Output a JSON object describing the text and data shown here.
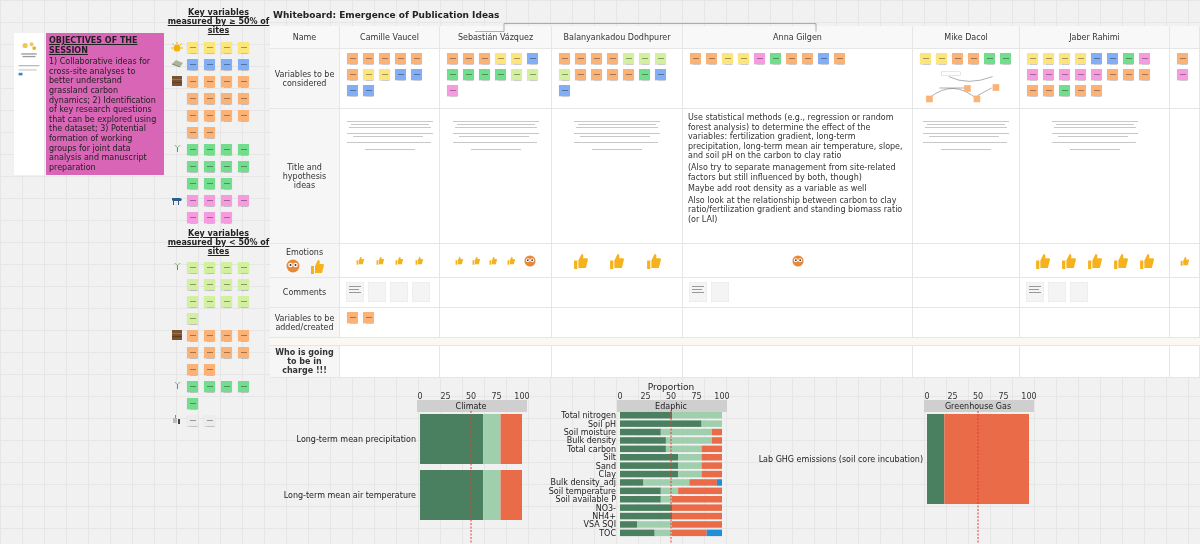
{
  "intro": {
    "objectives_title": "OBJECTIVES OF THE SESSION",
    "objectives": "1) Collaborative ideas for cross-site analyses to better understand grassland carbon dynamics; 2) Identification of key research questions that can be explored using the dataset; 3) Potential formation of working groups for joint data analysis and manuscript preparation"
  },
  "key_variables": [
    {
      "heading": "Key variables measured by ≥ 50% of sites",
      "groups": [
        {
          "kind": "sun",
          "notes": [
            {
              "color": "#fce57b"
            },
            {
              "color": "#fce57b"
            },
            {
              "color": "#fce57b"
            },
            {
              "color": "#fce57b"
            }
          ]
        },
        {
          "kind": "stone",
          "notes": [
            {
              "color": "#82aef5"
            },
            {
              "color": "#82aef5"
            },
            {
              "color": "#82aef5"
            },
            {
              "color": "#82aef5"
            }
          ]
        },
        {
          "kind": "soil",
          "notes": [
            {
              "color": "#fbb276"
            },
            {
              "color": "#fbb276"
            },
            {
              "color": "#fbb276"
            },
            {
              "color": "#fbb276"
            },
            {
              "color": "#fbb276"
            },
            {
              "color": "#fbb276"
            },
            {
              "color": "#fbb276"
            },
            {
              "color": "#fbb276"
            },
            {
              "color": "#fbb276"
            },
            {
              "color": "#fbb276"
            },
            {
              "color": "#fbb276"
            },
            {
              "color": "#fbb276"
            },
            {
              "color": "#fbb276"
            },
            {
              "color": "#fbb276"
            }
          ]
        },
        {
          "kind": "plant",
          "notes": [
            {
              "color": "#72dd8c"
            },
            {
              "color": "#72dd8c"
            },
            {
              "color": "#72dd8c"
            },
            {
              "color": "#72dd8c"
            },
            {
              "color": "#72dd8c"
            },
            {
              "color": "#72dd8c"
            },
            {
              "color": "#72dd8c"
            },
            {
              "color": "#72dd8c"
            },
            {
              "color": "#72dd8c"
            },
            {
              "color": "#72dd8c"
            },
            {
              "color": "#72dd8c"
            }
          ]
        },
        {
          "kind": "animal",
          "notes": [
            {
              "color": "#f69bdf"
            },
            {
              "color": "#f69bdf"
            },
            {
              "color": "#f69bdf"
            },
            {
              "color": "#f69bdf"
            },
            {
              "color": "#f69bdf"
            },
            {
              "color": "#f69bdf"
            },
            {
              "color": "#f69bdf"
            }
          ]
        }
      ]
    },
    {
      "heading": "Key variables measured by < 50% of sites",
      "groups": [
        {
          "kind": "plant",
          "notes": [
            {
              "color": "#d3f0a0"
            },
            {
              "color": "#d3f0a0"
            },
            {
              "color": "#d3f0a0"
            },
            {
              "color": "#d3f0a0"
            },
            {
              "color": "#d3f0a0"
            },
            {
              "color": "#d3f0a0"
            },
            {
              "color": "#d3f0a0"
            },
            {
              "color": "#d3f0a0"
            },
            {
              "color": "#d3f0a0"
            },
            {
              "color": "#d3f0a0"
            },
            {
              "color": "#d3f0a0"
            },
            {
              "color": "#d3f0a0"
            },
            {
              "color": "#d3f0a0"
            }
          ]
        },
        {
          "kind": "soil",
          "notes": [
            {
              "color": "#fbb276"
            },
            {
              "color": "#fbb276"
            },
            {
              "color": "#fbb276"
            },
            {
              "color": "#fbb276"
            },
            {
              "color": "#fbb276"
            },
            {
              "color": "#fbb276"
            },
            {
              "color": "#fbb276"
            },
            {
              "color": "#fbb276"
            },
            {
              "color": "#fbb276"
            },
            {
              "color": "#fbb276"
            }
          ]
        },
        {
          "kind": "plant",
          "notes": [
            {
              "color": "#72dd8c"
            },
            {
              "color": "#72dd8c"
            },
            {
              "color": "#72dd8c"
            },
            {
              "color": "#72dd8c"
            },
            {
              "color": "#72dd8c"
            }
          ]
        },
        {
          "kind": "tools",
          "notes": [
            {
              "color": "#ececec"
            },
            {
              "color": "#ececec"
            }
          ]
        }
      ]
    }
  ],
  "board": {
    "title": "Whiteboard: Emergence of Publication Ideas",
    "name_label": "Name",
    "row_labels": [
      "Variables to be considered",
      "Title and hypothesis ideas",
      "Emotions",
      "Comments",
      "Variables to be added/created",
      "Who is going to be in charge !!!"
    ],
    "columns": [
      {
        "name": "Camille Vaucel",
        "variables": [
          {
            "color": "#fbb276"
          },
          {
            "color": "#fbb276"
          },
          {
            "color": "#fbb276"
          },
          {
            "color": "#fbb276"
          },
          {
            "color": "#fbb276"
          },
          {
            "color": "#fbb276"
          },
          {
            "color": "#fce57b"
          },
          {
            "color": "#fce57b"
          },
          {
            "color": "#82aef5"
          },
          {
            "color": "#82aef5"
          },
          {
            "color": "#82aef5"
          },
          {
            "color": "#82aef5"
          }
        ],
        "added": [
          {
            "color": "#fbb276"
          },
          {
            "color": "#fbb276"
          }
        ]
      },
      {
        "name": "Sebastián Vázquez",
        "variables": [
          {
            "color": "#fbb276"
          },
          {
            "color": "#fbb276"
          },
          {
            "color": "#fbb276"
          },
          {
            "color": "#fce57b"
          },
          {
            "color": "#fce57b"
          },
          {
            "color": "#82aef5"
          },
          {
            "color": "#72dd8c"
          },
          {
            "color": "#72dd8c"
          },
          {
            "color": "#72dd8c"
          },
          {
            "color": "#72dd8c"
          },
          {
            "color": "#d3f0a0"
          },
          {
            "color": "#d3f0a0"
          },
          {
            "color": "#f69bdf"
          }
        ]
      },
      {
        "name": "Balanyankadou Dodhpurer",
        "variables": [
          {
            "color": "#fbb276"
          },
          {
            "color": "#fbb276"
          },
          {
            "color": "#fbb276"
          },
          {
            "color": "#fbb276"
          },
          {
            "color": "#d3f0a0"
          },
          {
            "color": "#d3f0a0"
          },
          {
            "color": "#d3f0a0"
          },
          {
            "color": "#d3f0a0"
          },
          {
            "color": "#fbb276"
          },
          {
            "color": "#fbb276"
          },
          {
            "color": "#fbb276"
          },
          {
            "color": "#fbb276"
          },
          {
            "color": "#72dd8c"
          },
          {
            "color": "#82aef5"
          },
          {
            "color": "#82aef5"
          }
        ]
      },
      {
        "name": "Anna Gilgen",
        "variables": [
          {
            "color": "#fbb276"
          },
          {
            "color": "#fbb276"
          },
          {
            "color": "#fce57b"
          },
          {
            "color": "#fce57b"
          },
          {
            "color": "#f69bdf"
          },
          {
            "color": "#72dd8c"
          },
          {
            "color": "#fbb276"
          },
          {
            "color": "#fbb276"
          },
          {
            "color": "#82aef5"
          },
          {
            "color": "#fbb276"
          }
        ],
        "hypotheses": [
          "Use statistical methods (e.g., regression or random forest analysis) to determine the effect of the variables: fertilization gradient, long-term precipitation, long-term mean air temperature, slope, and soil pH on the carbon to clay ratio",
          "(Also try to separate management from site-related factors but still influenced by both, though)",
          "Maybe add root density as a variable as well",
          "Also look at the relationship between carbon to clay ratio/fertilization gradient and standing biomass ratio (or LAI)"
        ]
      },
      {
        "name": "Mike Dacol",
        "variables": [
          {
            "color": "#fce57b"
          },
          {
            "color": "#fce57b"
          },
          {
            "color": "#fbb276"
          },
          {
            "color": "#fbb276"
          },
          {
            "color": "#72dd8c"
          },
          {
            "color": "#72dd8c"
          }
        ]
      },
      {
        "name": "Jaber Rahimi",
        "variables": [
          {
            "color": "#fce57b"
          },
          {
            "color": "#fce57b"
          },
          {
            "color": "#fce57b"
          },
          {
            "color": "#fce57b"
          },
          {
            "color": "#82aef5"
          },
          {
            "color": "#82aef5"
          },
          {
            "color": "#72dd8c"
          },
          {
            "color": "#f69bdf"
          },
          {
            "color": "#f69bdf"
          },
          {
            "color": "#f69bdf"
          },
          {
            "color": "#f69bdf"
          },
          {
            "color": "#f69bdf"
          },
          {
            "color": "#f69bdf"
          },
          {
            "color": "#fbb276"
          },
          {
            "color": "#fbb276"
          },
          {
            "color": "#fbb276"
          },
          {
            "color": "#fbb276"
          },
          {
            "color": "#fbb276"
          },
          {
            "color": "#72dd8c"
          },
          {
            "color": "#fbb276"
          },
          {
            "color": "#fbb276"
          }
        ]
      },
      {
        "variables": [
          {
            "color": "#fbb276"
          },
          {
            "color": "#f69bdf"
          }
        ]
      }
    ]
  },
  "charts": [
    {
      "chart_data": {
        "type": "bar",
        "orientation": "horizontal",
        "stacked": true,
        "title": "Climate",
        "categories": [
          "Long-term mean precipitation",
          "Long-term mean air temperature"
        ],
        "xlim": [
          0,
          100
        ],
        "xticks": [
          0,
          25,
          50,
          75,
          100
        ],
        "ref_lines": [
          {
            "axis": "x",
            "value": 50
          }
        ],
        "series": [
          {
            "color": "#4a8060",
            "values": [
              62,
              62
            ]
          },
          {
            "color": "#9fcfad",
            "values": [
              17,
              17
            ]
          },
          {
            "color": "#ea6b48",
            "values": [
              21,
              21
            ]
          }
        ]
      }
    },
    {
      "chart_data": {
        "type": "bar",
        "orientation": "horizontal",
        "stacked": true,
        "title": "Edaphic",
        "xlabel": "Proportion",
        "categories": [
          "Total nitrogen",
          "Soil pH",
          "Soil moisture",
          "Bulk density",
          "Total carbon",
          "Silt",
          "Sand",
          "Clay",
          "Bulk density_adj",
          "Soil temperature",
          "Soil available P",
          "NO3-",
          "NH4+",
          "VSA SQI",
          "TOC"
        ],
        "xlim": [
          0,
          100
        ],
        "xticks": [
          0,
          25,
          50,
          75,
          100
        ],
        "ref_lines": [
          {
            "axis": "x",
            "value": 50
          }
        ],
        "series": [
          {
            "color": "#4a8060",
            "values": [
              51,
              80,
              40,
              45,
              45,
              57,
              57,
              57,
              23,
              40,
              40,
              51,
              51,
              17,
              34
            ]
          },
          {
            "color": "#9fcfad",
            "values": [
              49,
              20,
              50,
              45,
              35,
              23,
              23,
              23,
              45,
              17,
              11,
              0,
              0,
              34,
              17
            ]
          },
          {
            "color": "#ea6b48",
            "values": [
              0,
              0,
              10,
              10,
              20,
              20,
              20,
              20,
              27,
              43,
              49,
              49,
              49,
              49,
              34
            ]
          },
          {
            "color": "#1f8fd6",
            "values": [
              0,
              0,
              0,
              0,
              0,
              0,
              0,
              0,
              5,
              0,
              0,
              0,
              0,
              0,
              15
            ]
          }
        ]
      }
    },
    {
      "chart_data": {
        "type": "bar",
        "orientation": "horizontal",
        "stacked": true,
        "title": "Greenhouse Gas",
        "categories": [
          "Lab GHG emissions (soil core incubation)"
        ],
        "xlim": [
          0,
          100
        ],
        "xticks": [
          0,
          25,
          50,
          75,
          100
        ],
        "ref_lines": [
          {
            "axis": "x",
            "value": 50
          }
        ],
        "series": [
          {
            "color": "#4a8060",
            "values": [
              17
            ]
          },
          {
            "color": "#ea6b48",
            "values": [
              83
            ]
          }
        ]
      }
    }
  ]
}
